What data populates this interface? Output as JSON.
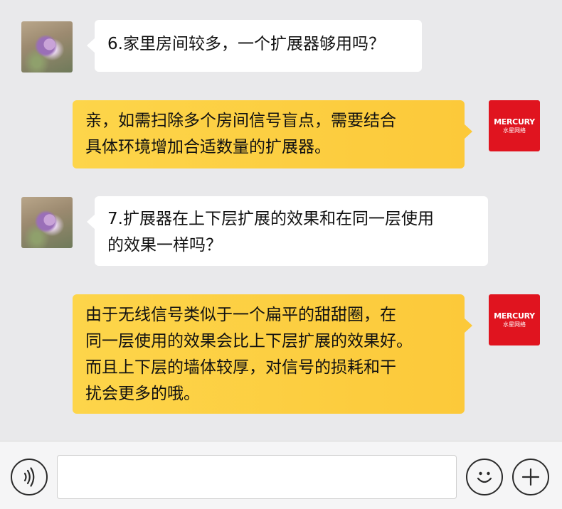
{
  "brand": {
    "name": "MERCURY",
    "sub": "水星网络",
    "color": "#e0141f"
  },
  "messages": [
    {
      "side": "left",
      "sender": "user",
      "text": "6.家里房间较多，一个扩展器够用吗？"
    },
    {
      "side": "right",
      "sender": "brand",
      "text": "亲，如需扫除多个房间信号盲点，需要结合\n具体环境增加合适数量的扩展器。"
    },
    {
      "side": "left",
      "sender": "user",
      "text": "7.扩展器在上下层扩展的效果和在同一层使用\n的效果一样吗？"
    },
    {
      "side": "right",
      "sender": "brand",
      "text": "由于无线信号类似于一个扁平的甜甜圈，在\n同一层使用的效果会比上下层扩展的效果好。\n而且上下层的墙体较厚，对信号的损耗和干\n扰会更多的哦。"
    }
  ],
  "toolbar": {
    "voice_icon": "voice-icon",
    "emoji_icon": "emoji-icon",
    "plus_icon": "plus-icon",
    "input_value": ""
  },
  "colors": {
    "chat_bg": "#e9e9eb",
    "bubble_left": "#ffffff",
    "bubble_right": "#fcc93a"
  }
}
